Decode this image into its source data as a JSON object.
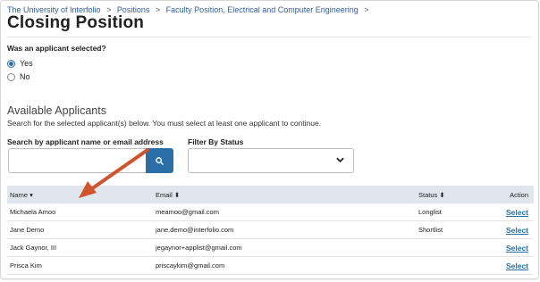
{
  "breadcrumb": {
    "items": [
      "The University of Interfolio",
      "Positions",
      "Faculty Position, Electrical and Computer Engineering"
    ],
    "separator": ">"
  },
  "page": {
    "title": "Closing Position"
  },
  "selection_question": {
    "label": "Was an applicant selected?",
    "options": [
      {
        "label": "Yes",
        "checked": true
      },
      {
        "label": "No",
        "checked": false
      }
    ]
  },
  "applicants_section": {
    "title": "Available Applicants",
    "description": "Search for the selected applicant(s) below. You must select at least one applicant to continue.",
    "search_label": "Search by applicant name or email address",
    "search_value": "",
    "filter_label": "Filter By Status",
    "filter_value": ""
  },
  "table": {
    "headers": {
      "name": "Name",
      "email": "Email",
      "status": "Status",
      "action": "Action"
    },
    "sort_icons": {
      "name": "▾",
      "email": "⬍",
      "status": "⬍"
    },
    "rows": [
      {
        "name": "Michaela Amoo",
        "email": "meamoo@gmail.com",
        "status": "Longlist",
        "action": "Select"
      },
      {
        "name": "Jane Demo",
        "email": "jane.demo@interfolio.com",
        "status": "Shortlist",
        "action": "Select"
      },
      {
        "name": "Jack Gaynor, III",
        "email": "jegaynor+applist@gmail.com",
        "status": "",
        "action": "Select"
      },
      {
        "name": "Prisca Kim",
        "email": "priscaykim@gmail.com",
        "status": "",
        "action": "Select"
      }
    ]
  },
  "colors": {
    "accent": "#2a6fa8",
    "annotation_arrow": "#d1532b",
    "table_header_bg": "#dfe6ee"
  }
}
